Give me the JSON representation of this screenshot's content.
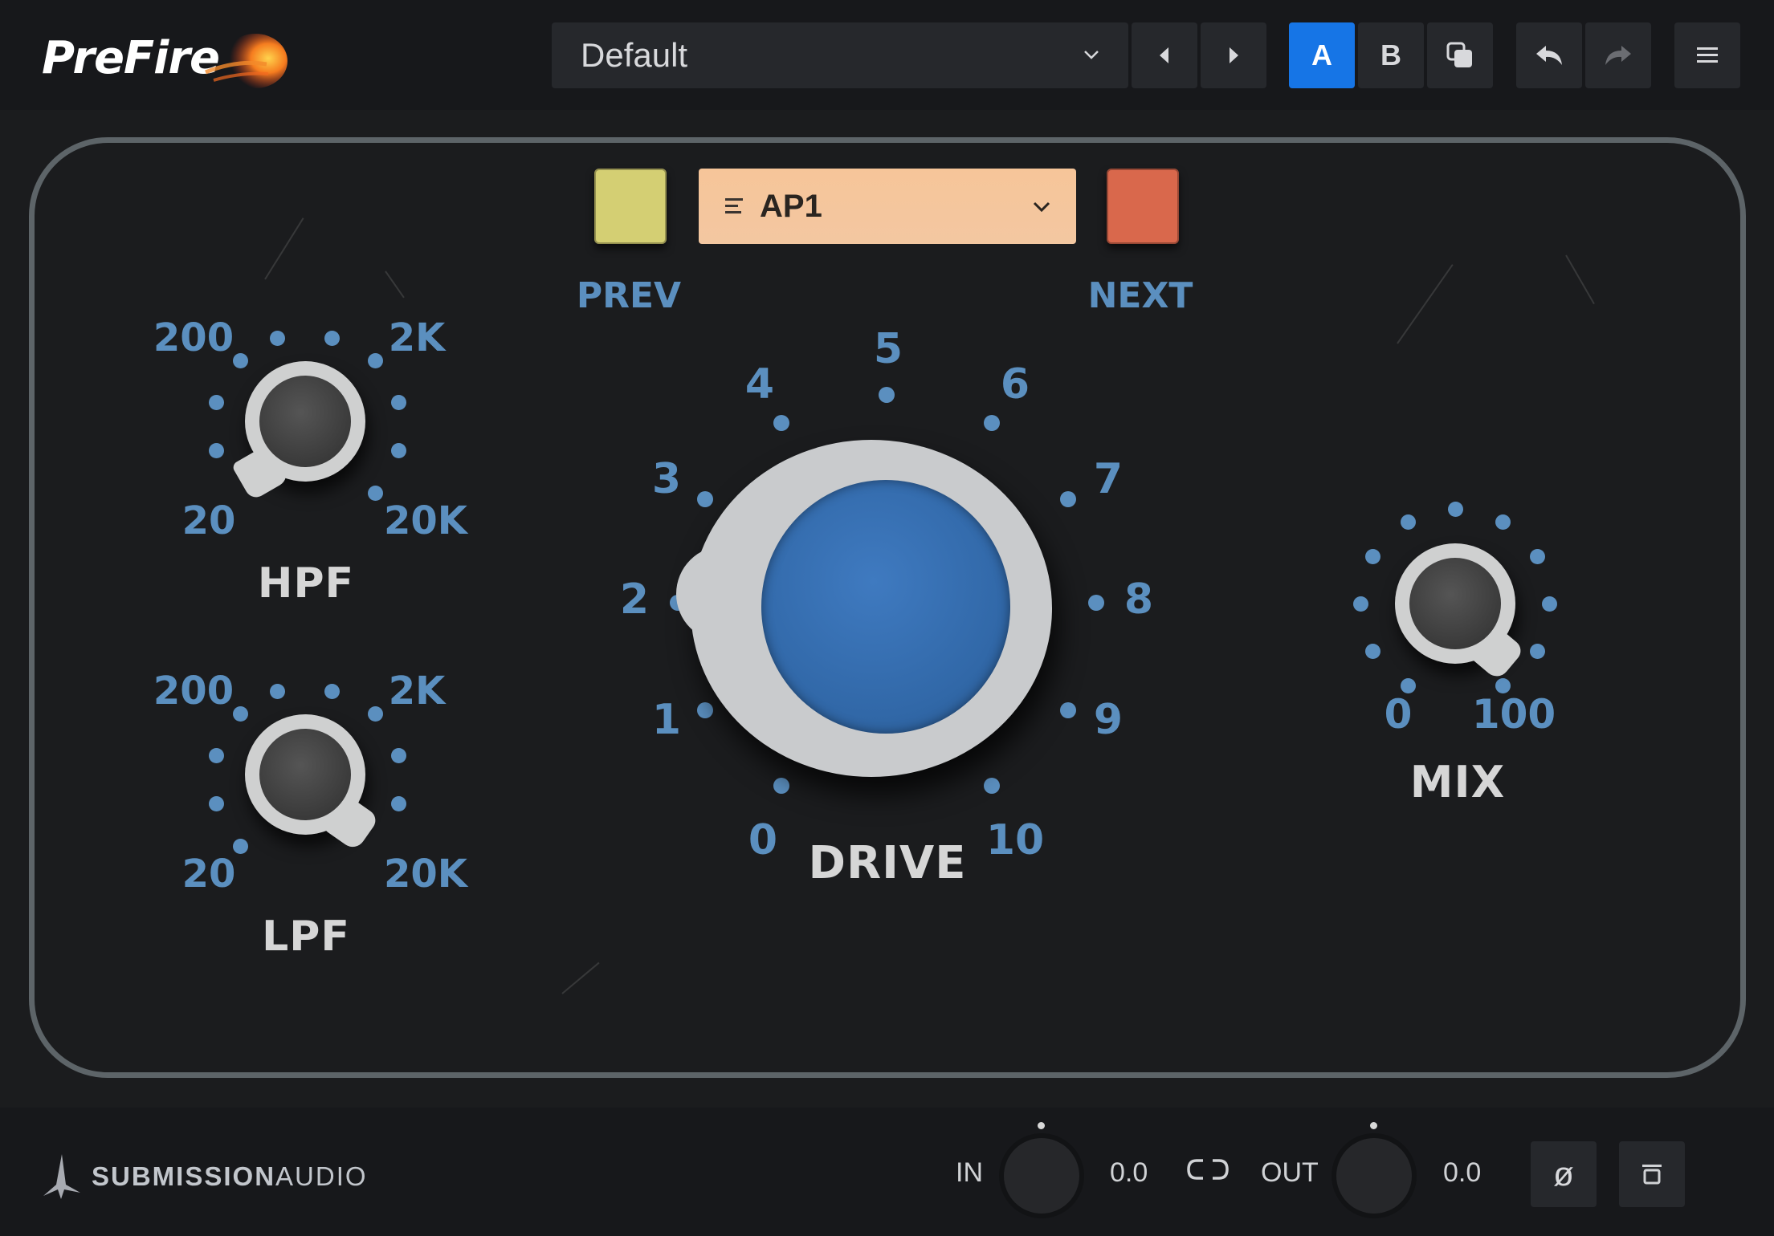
{
  "header": {
    "logo_text": "PreFire",
    "preset": {
      "value": "Default"
    },
    "ab": {
      "a_label": "A",
      "b_label": "B"
    }
  },
  "panel": {
    "style_select": {
      "value": "AP1"
    },
    "prev_label": "PREV",
    "next_label": "NEXT",
    "prev_color": "#d4cf73",
    "next_color": "#d9684c",
    "hpf": {
      "label": "HPF",
      "scale": {
        "min_low": "20",
        "low": "200",
        "high": "2K",
        "max_high": "20K"
      }
    },
    "lpf": {
      "label": "LPF",
      "scale": {
        "min_low": "20",
        "low": "200",
        "high": "2K",
        "max_high": "20K"
      }
    },
    "drive": {
      "label": "DRIVE",
      "scale": [
        "0",
        "1",
        "2",
        "3",
        "4",
        "5",
        "6",
        "7",
        "8",
        "9",
        "10"
      ]
    },
    "mix": {
      "label": "MIX",
      "scale": {
        "min": "0",
        "max": "100"
      }
    },
    "accent_blue": "#5b8fbf"
  },
  "footer": {
    "brand_bold": "SUBMISSION",
    "brand_light": "AUDIO",
    "in_label": "IN",
    "in_value": "0.0",
    "out_label": "OUT",
    "out_value": "0.0",
    "phase_symbol": "ø"
  }
}
